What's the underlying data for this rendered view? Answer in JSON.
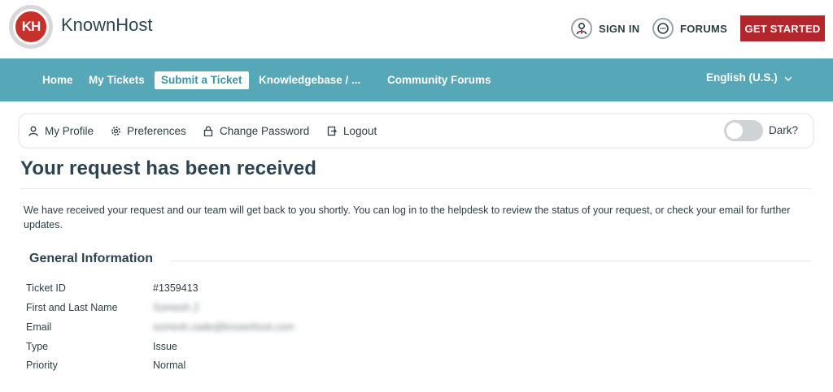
{
  "header": {
    "brand": "KnownHost",
    "logo_letters": "KH",
    "sign_in": "SIGN IN",
    "forums": "FORUMS",
    "get_started": "GET STARTED"
  },
  "nav": {
    "items": [
      {
        "label": "Home"
      },
      {
        "label": "My Tickets"
      },
      {
        "label": "Submit a Ticket"
      },
      {
        "label": "Knowledgebase / ..."
      },
      {
        "label": "Community Forums"
      }
    ],
    "language": "English (U.S.)"
  },
  "profile_bar": {
    "my_profile": "My Profile",
    "preferences": "Preferences",
    "change_password": "Change Password",
    "logout": "Logout",
    "dark_label": "Dark?"
  },
  "content": {
    "title": "Your request has been received",
    "intro": "We have received your request and our team will get back to you shortly. You can log in to the helpdesk to review the status of your request, or check your email for further updates.",
    "section_title": "General Information",
    "fields": [
      {
        "label": "Ticket ID",
        "value": "#1359413"
      },
      {
        "label": "First and Last Name",
        "value": "Somesh Z"
      },
      {
        "label": "Email",
        "value": "somesh.zade@knownhost.com"
      },
      {
        "label": "Type",
        "value": "Issue"
      },
      {
        "label": "Priority",
        "value": "Normal"
      }
    ]
  },
  "colors": {
    "nav_bg": "#56a8b8",
    "brand_red": "#b3262b",
    "text_dark": "#2c3e46"
  }
}
